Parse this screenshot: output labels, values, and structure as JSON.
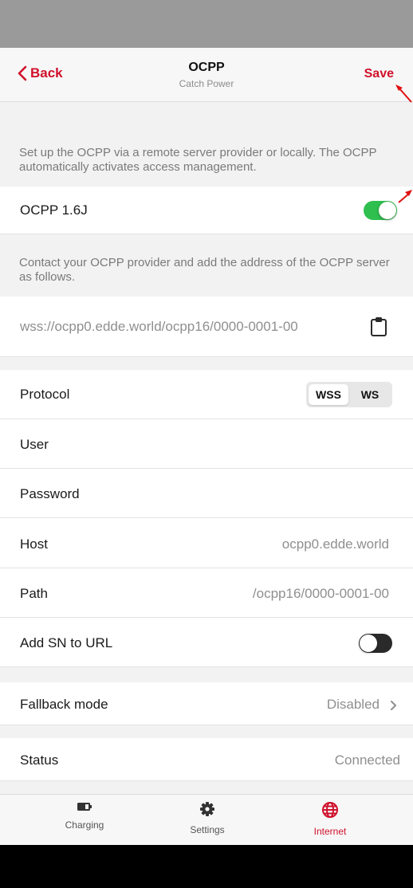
{
  "header": {
    "back_label": "Back",
    "title": "OCPP",
    "subtitle": "Catch Power",
    "save_label": "Save"
  },
  "intro_text": "Set up the OCPP via a remote server provider or locally. The OCPP automatically activates access management.",
  "ocpp_toggle": {
    "label": "OCPP 1.6J",
    "on": true
  },
  "provider_text": "Contact your OCPP provider and add the address of the OCPP server as follows.",
  "server_url": "wss://ocpp0.edde.world/ocpp16/0000-0001-00",
  "protocol": {
    "label": "Protocol",
    "options": [
      "WSS",
      "WS"
    ],
    "selected": "WSS"
  },
  "user": {
    "label": "User",
    "value": ""
  },
  "password": {
    "label": "Password",
    "value": ""
  },
  "host": {
    "label": "Host",
    "value": "ocpp0.edde.world"
  },
  "path": {
    "label": "Path",
    "value": "/ocpp16/0000-0001-00"
  },
  "add_sn": {
    "label": "Add SN to URL",
    "on": false
  },
  "fallback": {
    "label": "Fallback mode",
    "value": "Disabled"
  },
  "status": {
    "label": "Status",
    "value": "Connected"
  },
  "tabs": [
    {
      "label": "Charging",
      "icon": "battery-icon"
    },
    {
      "label": "Settings",
      "icon": "gear-icon"
    },
    {
      "label": "Internet",
      "icon": "globe-icon",
      "active": true
    }
  ],
  "colors": {
    "accent": "#d0102b",
    "toggle_on": "#2fbf4f",
    "toggle_off": "#2a2a2a"
  }
}
